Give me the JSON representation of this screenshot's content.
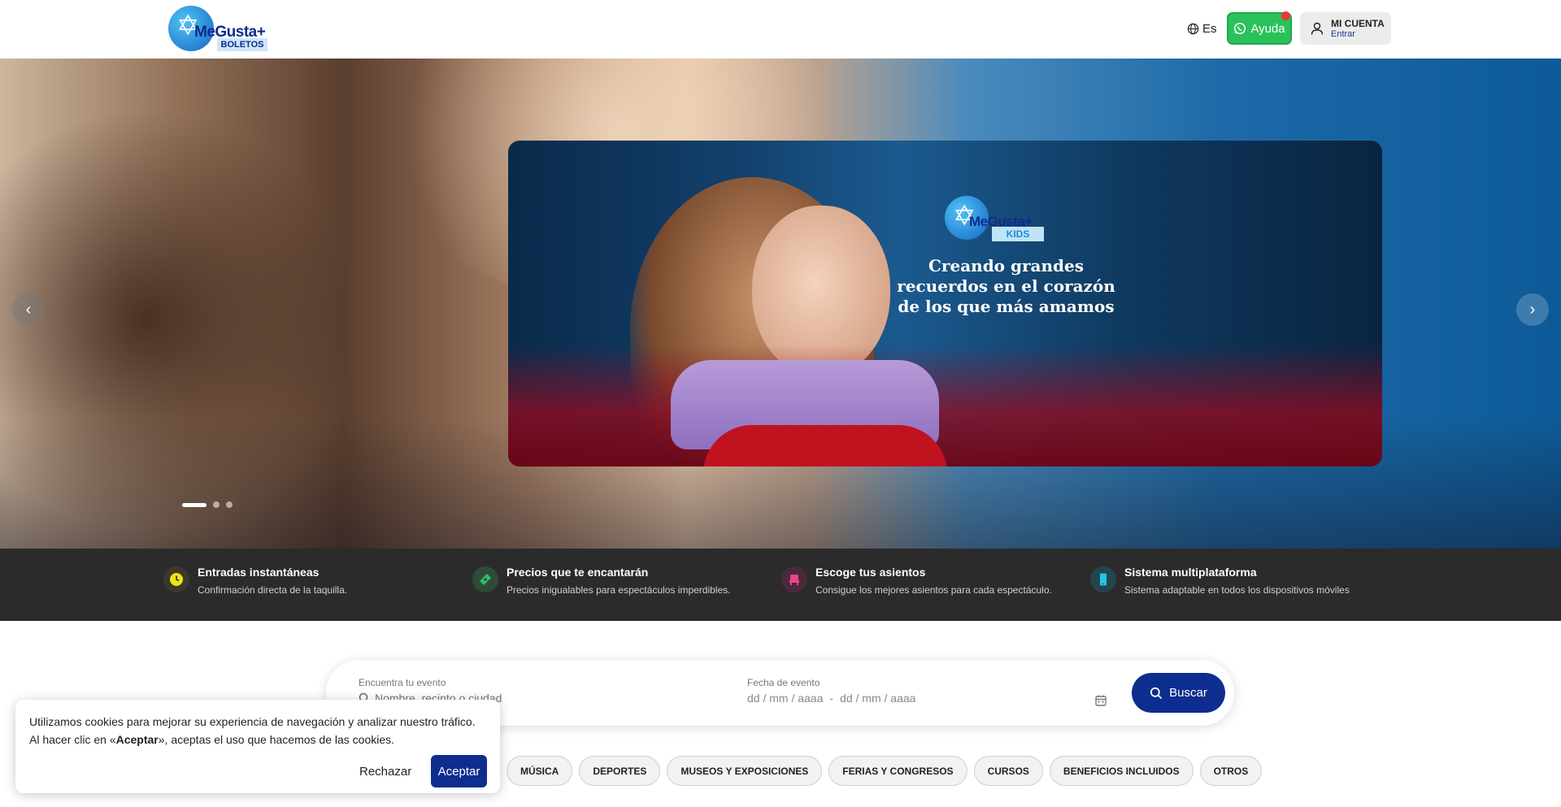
{
  "header": {
    "logo": {
      "brand": "MeGusta+",
      "sub": "BOLETOS"
    },
    "language": "Es",
    "help_label": "Ayuda",
    "account_title": "MI CUENTA",
    "account_sub": "Entrar"
  },
  "hero": {
    "slide_logo": {
      "brand": "MeGusta+",
      "sub": "KIDS"
    },
    "slide_caption": "Creando grandes recuerdos en el corazón de los que más amamos",
    "active_slide": 1,
    "slide_count": 3
  },
  "features": [
    {
      "icon": "clock-icon",
      "color": "#f2e318",
      "title": "Entradas instantáneas",
      "desc": "Confirmación directa de la taquilla."
    },
    {
      "icon": "ticket-icon",
      "color": "#2fbf6a",
      "title": "Precios que te encantarán",
      "desc": "Precios inigualables para espectáculos imperdibles."
    },
    {
      "icon": "seat-icon",
      "color": "#e8458b",
      "title": "Escoge tus asientos",
      "desc": "Consigue los mejores asientos para cada espectáculo."
    },
    {
      "icon": "mobile-icon",
      "color": "#23c4e8",
      "title": "Sistema multiplataforma",
      "desc": "Sistema adaptable en todos los dispositivos móviles"
    }
  ],
  "search": {
    "event_label": "Encuentra tu evento",
    "event_placeholder": "Nombre, recinto o ciudad",
    "date_label": "Fecha de evento",
    "date_from": "dd / mm / aaaa",
    "date_separator": "-",
    "date_to": "dd / mm / aaaa",
    "button_label": "Buscar"
  },
  "categories": [
    "MÚSICA",
    "DEPORTES",
    "MUSEOS Y EXPOSICIONES",
    "FERIAS Y CONGRESOS",
    "CURSOS",
    "BENEFICIOS INCLUIDOS",
    "OTROS"
  ],
  "cookie": {
    "line1": "Utilizamos cookies para mejorar su experiencia de navegación y analizar nuestro tráfico.",
    "line2_prefix": "Al hacer clic en «",
    "line2_bold": "Aceptar",
    "line2_suffix": "», aceptas el uso que hacemos de las cookies.",
    "reject_label": "Rechazar",
    "accept_label": "Aceptar"
  }
}
